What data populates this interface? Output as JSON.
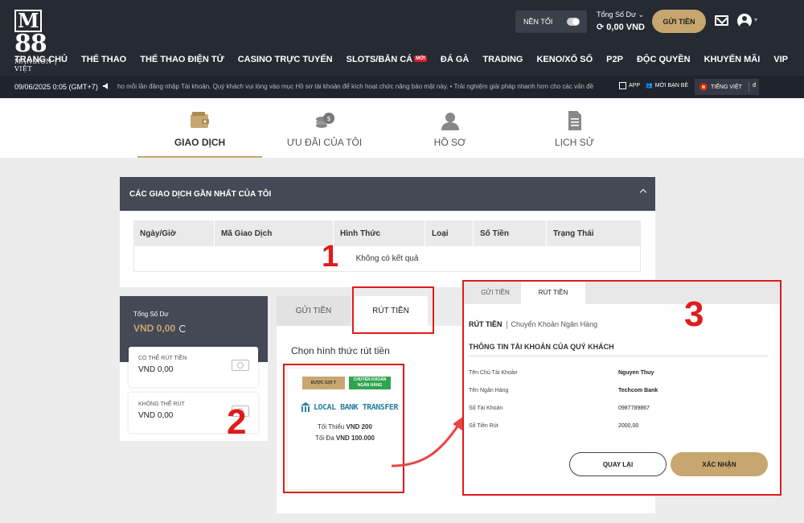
{
  "header": {
    "logo_mark": "88",
    "logo_sub": "MANSION | VIỆT",
    "dark_mode_label": "NỀN TỐI",
    "balance_label": "Tổng Số Dư",
    "balance_value": "0,00 VND",
    "deposit_label": "GỬI TIỀN"
  },
  "nav": {
    "items": [
      "TRANG CHỦ",
      "THỂ THAO",
      "THỂ THAO ĐIỆN TỬ",
      "CASINO TRỰC TUYẾN",
      "SLOTS/BẮN CÁ",
      "ĐÁ GÀ",
      "TRADING",
      "KENO/XỔ SỐ",
      "P2P",
      "ĐỘC QUYỀN",
      "KHUYẾN MÃI",
      "VIP"
    ],
    "new_badge": "MỚI"
  },
  "ticker": {
    "datetime": "09/06/2025 0:05 (GMT+7)",
    "text": "ho mỗi lần đăng nhập Tài khoản. Quý khách vui lòng vào mục Hồ sơ tài khoản để kích hoạt chức năng bảo mật này.   •   Trải nghiệm giải pháp nhanh hơn cho các vấn đề",
    "app": "APP",
    "refer": "MỜI BẠN BÈ",
    "language": "TIẾNG VIỆT",
    "lang_short": "đ"
  },
  "main_tabs": [
    {
      "label": "GIAO DỊCH",
      "icon": "wallet-icon"
    },
    {
      "label": "ƯU ĐÃI CỦA TÔI",
      "icon": "coins-icon"
    },
    {
      "label": "HỒ SƠ",
      "icon": "profile-icon"
    },
    {
      "label": "LỊCH SỬ",
      "icon": "document-icon"
    }
  ],
  "recent": {
    "title": "CÁC GIAO DỊCH GẦN NHẤT CỦA TÔI",
    "columns": [
      "Ngày/Giờ",
      "Mã Giao Dịch",
      "Hình Thức",
      "Loại",
      "Số Tiền",
      "Trạng Thái"
    ],
    "empty": "Không có kết quả"
  },
  "balance_card": {
    "total_label": "Tổng Số Dư",
    "total_value": "VND 0,00",
    "withdrawable_label": "CÓ THỂ RÚT TIỀN",
    "withdrawable_value": "VND 0,00",
    "non_withdrawable_label": "KHÔNG THỂ RÚT",
    "non_withdrawable_value": "VND 0,00"
  },
  "withdraw_panel": {
    "tab_deposit": "GỬI TIỀN",
    "tab_withdraw": "RÚT TIỀN",
    "choose_method": "Chọn hình thức rút tiền",
    "tag_recommended": "ĐƯỢC GỢI Ý",
    "tag_bank_line1": "CHUYỂN KHOẢN",
    "tag_bank_line2": "NGÂN HÀNG",
    "bank_name": "LOCAL BANK TRANSFER",
    "min_label": "Tối Thiểu",
    "min_value": "VND 200",
    "max_label": "Tối Đa",
    "max_value": "VND 100.000"
  },
  "confirm_panel": {
    "tab_deposit": "GỬI TIỀN",
    "tab_withdraw": "RÚT TIỀN",
    "bread_main": "RÚT TIỀN",
    "bread_sub": "Chuyển Khoản Ngân Hàng",
    "heading": "THÔNG TIN TÀI KHOẢN CỦA QUÝ KHÁCH",
    "rows": [
      {
        "label": "Tên Chủ Tài Khoản",
        "value": "Nguyen Thuy"
      },
      {
        "label": "Tên Ngân Hàng",
        "value": "Techcom Bank"
      },
      {
        "label": "Số Tài Khoản",
        "value": "0987789867"
      },
      {
        "label": "Số Tiền Rút",
        "value": "2000,00"
      }
    ],
    "back_label": "QUAY LẠI",
    "confirm_label": "XÁC NHẬN"
  },
  "annotations": {
    "one": "1",
    "two": "2",
    "three": "3"
  },
  "colors": {
    "gold": "#c7a66f",
    "header": "#262a33",
    "annotation": "#e01b1b",
    "bank_green": "#2fa44f"
  }
}
